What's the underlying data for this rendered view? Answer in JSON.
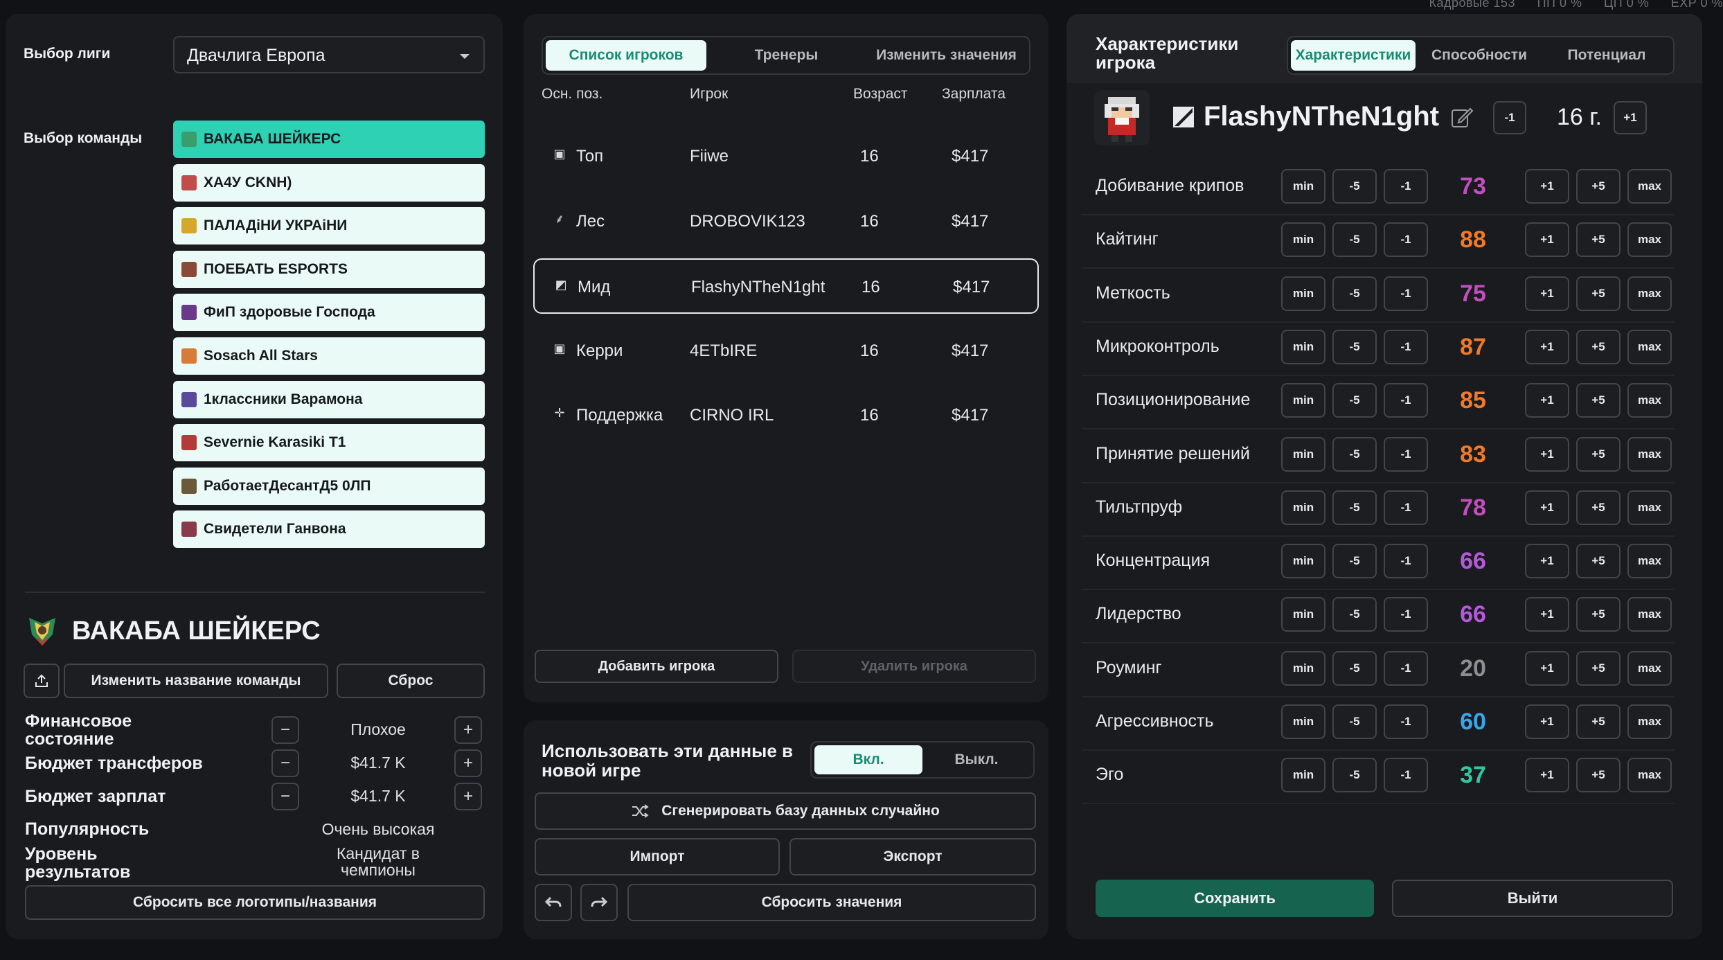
{
  "topbar": [
    "Кадровые 153",
    "ПП 0 %",
    "ЦП 0 %",
    "EXP 0 %"
  ],
  "left": {
    "league_label": "Выбор лиги",
    "league_value": "Двачлига Европа",
    "team_label": "Выбор команды",
    "teams": [
      {
        "name": "ВАКАБА ШЕЙКЕРС",
        "color": "#3a9d6c"
      },
      {
        "name": "ХА4У CKNH)",
        "color": "#c24b4b"
      },
      {
        "name": "ПАЛАДiНИ УКРАiНИ",
        "color": "#d6a82a"
      },
      {
        "name": "ПОЕБАТЬ ESPORTS",
        "color": "#8a4a3a"
      },
      {
        "name": "ФиП здоровые Господа",
        "color": "#6a3a8a"
      },
      {
        "name": "Sosach All Stars",
        "color": "#d87b3a"
      },
      {
        "name": "1классники Варамона",
        "color": "#5a4a9a"
      },
      {
        "name": "Severnie Karasiki T1",
        "color": "#b43a3a"
      },
      {
        "name": "РаботаетДесантД5 0ЛП",
        "color": "#6b5a3a"
      },
      {
        "name": "Свидетели Ганвона",
        "color": "#8a3a4a"
      }
    ],
    "current_team": "ВАКАБА ШЕЙКЕРС",
    "rename_button": "Изменить название команды",
    "reset_button": "Сброс",
    "finance_label": "Финансовое состояние",
    "finance_value": "Плохое",
    "transfer_label": "Бюджет трансферов",
    "transfer_value": "$41.7 K",
    "salary_label": "Бюджет зарплат",
    "salary_value": "$41.7 K",
    "popularity_label": "Популярность",
    "popularity_value": "Очень высокая",
    "results_label": "Уровень результатов",
    "results_value": "Кандидат в чемпионы",
    "reset_all_button": "Сбросить все логотипы/названия"
  },
  "mid": {
    "tabs": [
      "Список игроков",
      "Тренеры",
      "Изменить значения"
    ],
    "columns": [
      "Осн. поз.",
      "Игрок",
      "Возраст",
      "Зарплата"
    ],
    "players": [
      {
        "pos": "Топ",
        "icon": "top-lane-icon",
        "name": "Fiiwe",
        "age": "16",
        "salary": "$417"
      },
      {
        "pos": "Лес",
        "icon": "jungle-icon",
        "name": "DROBOVIK123",
        "age": "16",
        "salary": "$417"
      },
      {
        "pos": "Мид",
        "icon": "mid-lane-icon",
        "name": "FlashyNTheN1ght",
        "age": "16",
        "salary": "$417"
      },
      {
        "pos": "Керри",
        "icon": "carry-icon",
        "name": "4ETbIRE",
        "age": "16",
        "salary": "$417"
      },
      {
        "pos": "Поддержка",
        "icon": "support-icon",
        "name": "CIRNO IRL",
        "age": "16",
        "salary": "$417"
      }
    ],
    "add_player": "Добавить игрока",
    "remove_player": "Удалить игрока",
    "use_data_label": "Использовать эти данные в новой игре",
    "toggle_on": "Вкл.",
    "toggle_off": "Выкл.",
    "generate_button": "Сгенерировать базу данных случайно",
    "import_button": "Импорт",
    "export_button": "Экспорт",
    "reset_values_button": "Сбросить значения"
  },
  "right": {
    "title": "Характеристики игрока",
    "tabs": [
      "Характеристики",
      "Способности",
      "Потенциал"
    ],
    "player_name": "FlashyNTheN1ght",
    "age": "16 г.",
    "age_minus": "-1",
    "age_plus": "+1",
    "btn_labels": [
      "min",
      "-5",
      "-1",
      "+1",
      "+5",
      "max"
    ],
    "stats": [
      {
        "name": "Добивание крипов",
        "value": "73",
        "color": "#c34fbf"
      },
      {
        "name": "Кайтинг",
        "value": "88",
        "color": "#f07a28"
      },
      {
        "name": "Меткость",
        "value": "75",
        "color": "#c34fbf"
      },
      {
        "name": "Микроконтроль",
        "value": "87",
        "color": "#f07a28"
      },
      {
        "name": "Позиционирование",
        "value": "85",
        "color": "#f07a28"
      },
      {
        "name": "Принятие решений",
        "value": "83",
        "color": "#f07a28"
      },
      {
        "name": "Тильтпруф",
        "value": "78",
        "color": "#c34fbf"
      },
      {
        "name": "Концентрация",
        "value": "66",
        "color": "#b45ad9"
      },
      {
        "name": "Лидерство",
        "value": "66",
        "color": "#b45ad9"
      },
      {
        "name": "Роуминг",
        "value": "20",
        "color": "#8b8e95"
      },
      {
        "name": "Агрессивность",
        "value": "60",
        "color": "#3aa6e8"
      },
      {
        "name": "Эго",
        "value": "37",
        "color": "#2fc8a0"
      }
    ],
    "save_button": "Сохранить",
    "exit_button": "Выйти"
  }
}
